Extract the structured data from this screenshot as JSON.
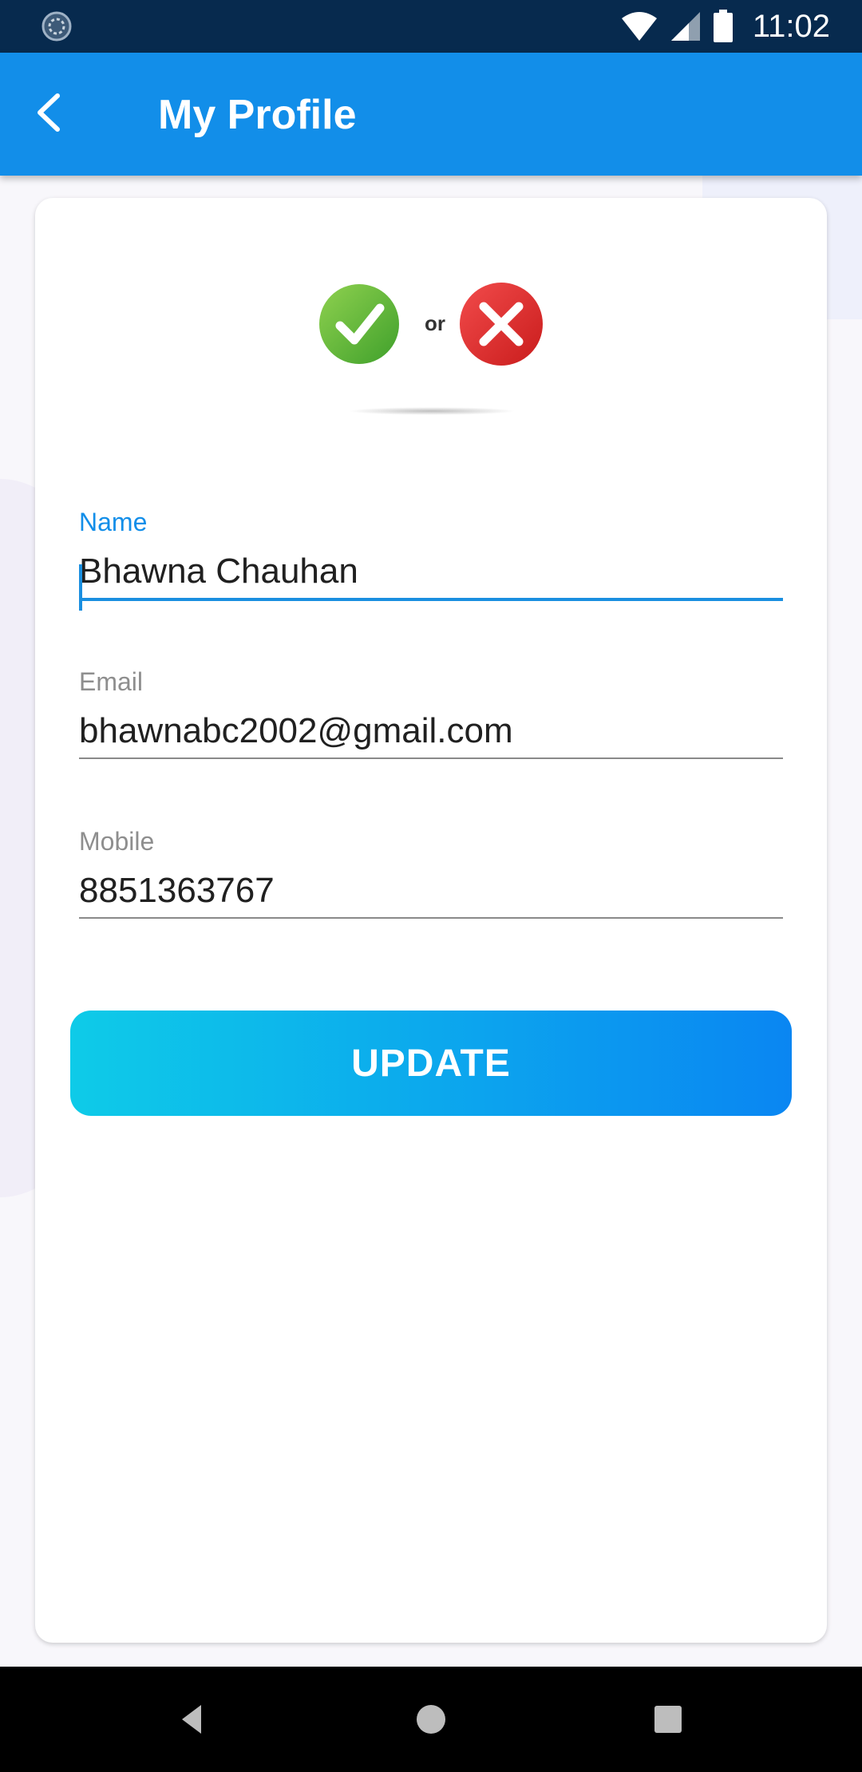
{
  "status_bar": {
    "time": "11:02",
    "icons": [
      "sync-icon",
      "wifi-icon",
      "signal-icon",
      "battery-icon"
    ]
  },
  "app_bar": {
    "title": "My Profile",
    "back_icon": "back-arrow-icon"
  },
  "logo": {
    "or_text": "or",
    "left_icon": "check-icon",
    "right_icon": "x-icon"
  },
  "form": {
    "name": {
      "label": "Name",
      "value": "Bhawna Chauhan"
    },
    "email": {
      "label": "Email",
      "value": "bhawnabc2002@gmail.com"
    },
    "mobile": {
      "label": "Mobile",
      "value": "8851363767"
    },
    "update_label": "UPDATE"
  },
  "nav_bar": {
    "icons": [
      "nav-back-icon",
      "nav-home-icon",
      "nav-recents-icon"
    ]
  },
  "colors": {
    "status_bar": "#072a4e",
    "app_bar": "#128ee9",
    "accent": "#1a8fe0",
    "button_start": "#0ecbe8",
    "button_end": "#0a86f2"
  }
}
